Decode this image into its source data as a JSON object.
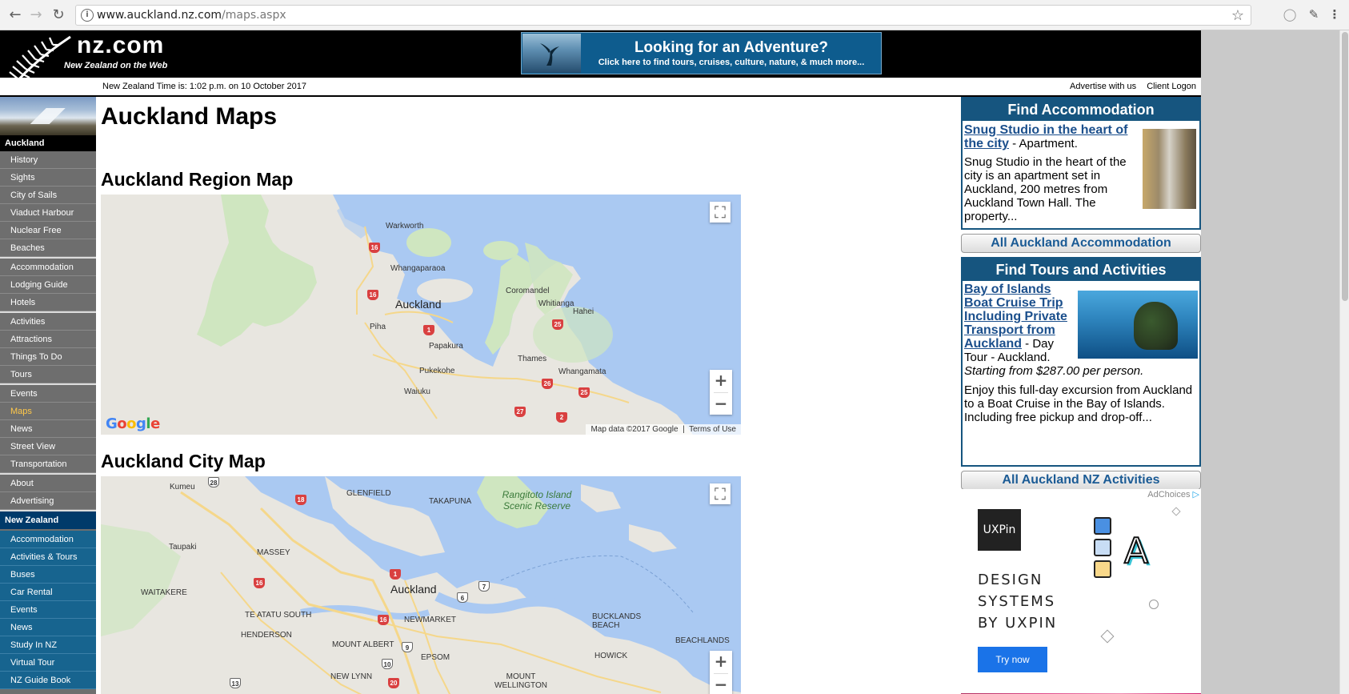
{
  "browser": {
    "url_host": "www.auckland.nz.com",
    "url_path": "/maps.aspx",
    "back_icon": "arrow-left-icon",
    "forward_icon": "arrow-right-icon",
    "reload_icon": "reload-icon"
  },
  "header": {
    "logo_text": "nz.com",
    "logo_sub": "New Zealand on the Web",
    "banner_title": "Looking for an Adventure?",
    "banner_sub": "Click here to find tours, cruises, culture, nature, & much more...",
    "time_text": "New Zealand Time is: 1:02 p.m. on 10 October 2017",
    "advertise": "Advertise with us",
    "client_logon": "Client Logon"
  },
  "sidebar": {
    "section1": "Auckland",
    "items1": [
      "History",
      "Sights",
      "City of Sails",
      "Viaduct Harbour",
      "Nuclear Free",
      "Beaches"
    ],
    "items2": [
      "Accommodation",
      "Lodging Guide",
      "Hotels"
    ],
    "items3": [
      "Activities",
      "Attractions",
      "Things To Do",
      "Tours"
    ],
    "items4": [
      "Events",
      "Maps",
      "News",
      "Street View",
      "Transportation"
    ],
    "items5": [
      "About",
      "Advertising"
    ],
    "section2": "New Zealand",
    "items6": [
      "Accommodation",
      "Activities & Tours",
      "Buses",
      "Car Rental",
      "Events",
      "News",
      "Study In NZ",
      "Virtual Tour",
      "NZ Guide Book"
    ],
    "active": "Maps"
  },
  "main": {
    "title": "Auckland Maps",
    "region_title": "Auckland Region Map",
    "city_title": "Auckland City Map",
    "map_attribution": "Map data ©2017 Google",
    "terms": "Terms of Use",
    "google": "Google",
    "region_labels": [
      "Warkworth",
      "Whangaparaoa",
      "Coromandel",
      "Whitianga",
      "Hahei",
      "Auckland",
      "Piha",
      "Papakura",
      "Thames",
      "Pukekohe",
      "Whangamata",
      "Waiuku"
    ],
    "region_roads": [
      "16",
      "16",
      "1",
      "25",
      "26",
      "25",
      "27",
      "2"
    ],
    "city_labels": [
      "Kumeu",
      "GLENFIELD",
      "TAKAPUNA",
      "Rangitoto Island Scenic Reserve",
      "Taupaki",
      "MASSEY",
      "WAITAKERE",
      "Auckland",
      "NEWMARKET",
      "TE ATATU SOUTH",
      "HENDERSON",
      "MOUNT ALBERT",
      "EPSOM",
      "BUCKLANDS BEACH",
      "HOWICK",
      "BEACHLANDS",
      "NEW LYNN",
      "MOUNT WELLINGTON"
    ],
    "city_roads": [
      "28",
      "18",
      "1",
      "16",
      "16",
      "6",
      "7",
      "9",
      "10",
      "13",
      "20"
    ]
  },
  "right": {
    "acc_head": "Find Accommodation",
    "acc_link": "Snug Studio in the heart of the city",
    "acc_type": " - Apartment.",
    "acc_desc": "Snug Studio in the heart of the city is an apartment set in Auckland, 200 metres from Auckland Town Hall. The property...",
    "acc_all": "All Auckland Accommodation",
    "tours_head": "Find Tours and Activities",
    "tour_link": "Bay of Islands Boat Cruise Trip Including Private Transport from Auckland",
    "tour_type": " - Day Tour - Auckland.",
    "tour_price": "Starting from $287.00 per person.",
    "tour_desc": "Enjoy this full-day excursion from Auckland to a Boat Cruise in the Bay of Islands. Including free pickup and drop-off...",
    "tours_all": "All Auckland NZ Activities",
    "adchoices": "AdChoices",
    "ad_logo": "UXPin",
    "ad_line1": "DESIGN",
    "ad_line2": "SYSTEMS",
    "ad_line3": "BY UXPIN",
    "ad_cta": "Try now",
    "ad_letter": "A"
  },
  "colors": {
    "sidebar_gray": "#6e6e6e",
    "sidebar_blue": "#17648f",
    "active_item": "#ffc84a",
    "box_head": "#16557f",
    "link": "#1b4f8c",
    "map_water": "#aac9f2",
    "map_land": "#e8e6e0",
    "road_shield": "#d94040"
  }
}
